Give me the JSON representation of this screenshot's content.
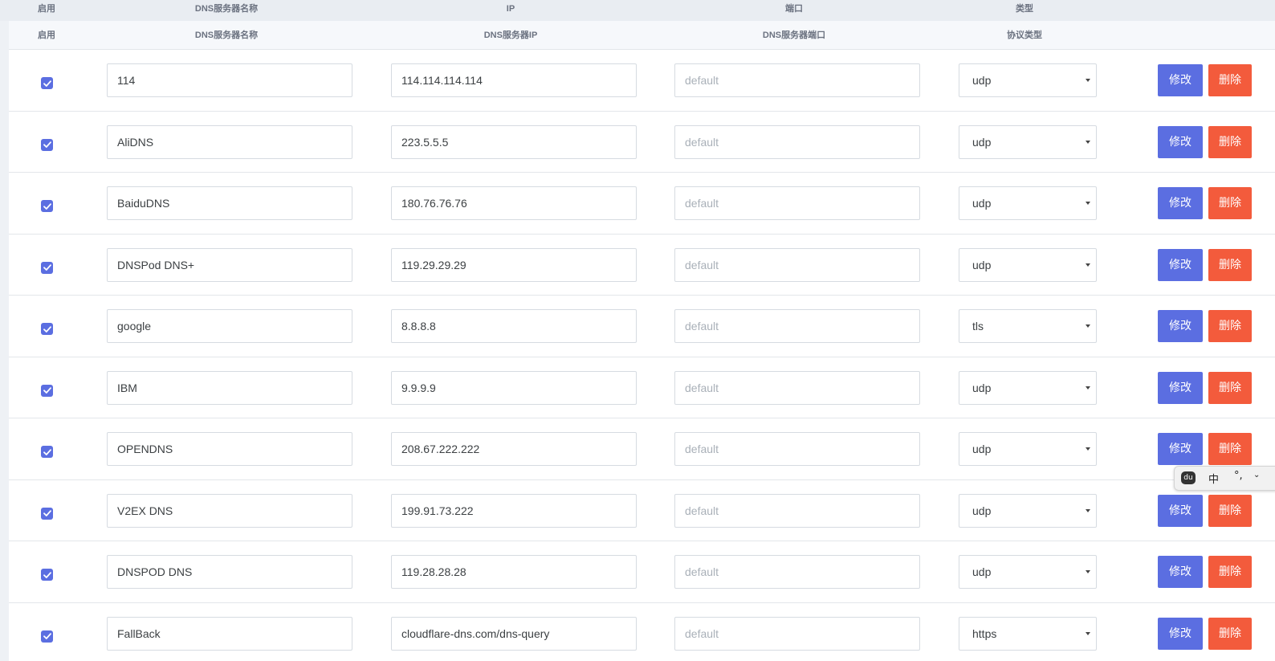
{
  "header_top": {
    "enable": "启用",
    "name": "DNS服务器名称",
    "ip": "IP",
    "port": "端口",
    "type": "类型"
  },
  "header_sub": {
    "enable": "启用",
    "name": "DNS服务器名称",
    "ip": "DNS服务器IP",
    "port": "DNS服务器端口",
    "type": "协议类型"
  },
  "port_placeholder": "default",
  "edit_label": "修改",
  "delete_label": "删除",
  "rows": [
    {
      "enabled": true,
      "name": "114",
      "ip": "114.114.114.114",
      "port": "",
      "protocol": "udp"
    },
    {
      "enabled": true,
      "name": "AliDNS",
      "ip": "223.5.5.5",
      "port": "",
      "protocol": "udp"
    },
    {
      "enabled": true,
      "name": "BaiduDNS",
      "ip": "180.76.76.76",
      "port": "",
      "protocol": "udp"
    },
    {
      "enabled": true,
      "name": "DNSPod DNS+",
      "ip": "119.29.29.29",
      "port": "",
      "protocol": "udp"
    },
    {
      "enabled": true,
      "name": "google",
      "ip": "8.8.8.8",
      "port": "",
      "protocol": "tls"
    },
    {
      "enabled": true,
      "name": "IBM",
      "ip": "9.9.9.9",
      "port": "",
      "protocol": "udp"
    },
    {
      "enabled": true,
      "name": "OPENDNS",
      "ip": "208.67.222.222",
      "port": "",
      "protocol": "udp"
    },
    {
      "enabled": true,
      "name": "V2EX DNS",
      "ip": "199.91.73.222",
      "port": "",
      "protocol": "udp"
    },
    {
      "enabled": true,
      "name": "DNSPOD DNS",
      "ip": "119.28.28.28",
      "port": "",
      "protocol": "udp"
    },
    {
      "enabled": true,
      "name": "FallBack",
      "ip": "cloudflare-dns.com/dns-query",
      "port": "",
      "protocol": "https"
    }
  ],
  "ime": {
    "logo": "du",
    "lang": "中",
    "punct": "°,",
    "more": "⌄"
  },
  "colors": {
    "accent": "#5b6ee1",
    "danger": "#f35b3c"
  }
}
